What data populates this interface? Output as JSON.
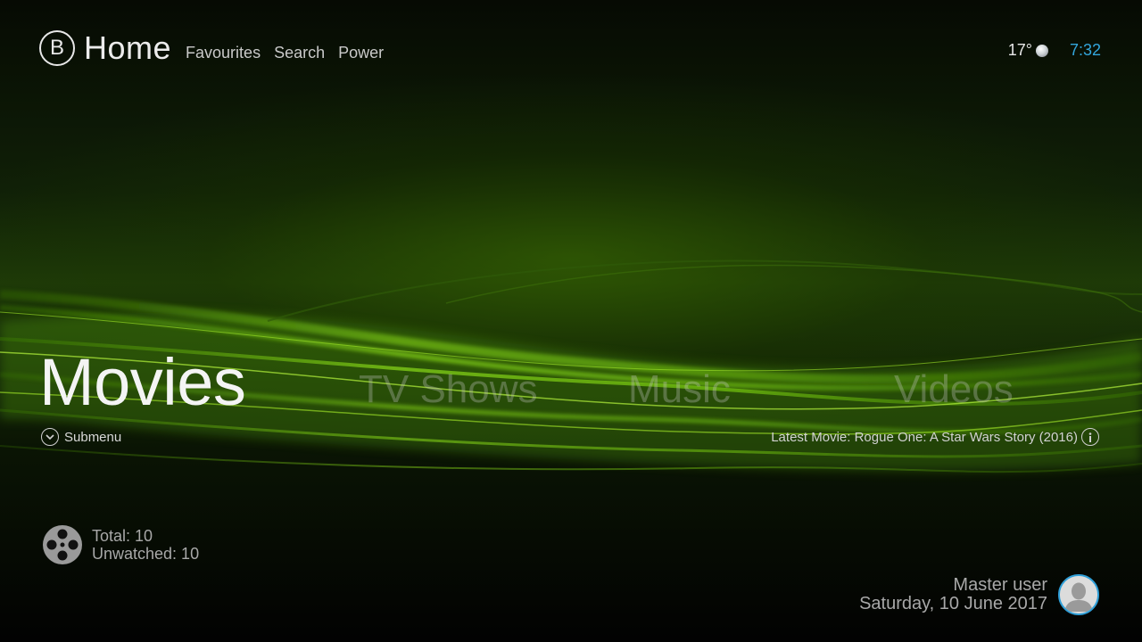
{
  "header": {
    "logo_letter": "B",
    "title": "Home",
    "nav": [
      "Favourites",
      "Search",
      "Power"
    ]
  },
  "status": {
    "temperature": "17°",
    "weather_icon": "weather-clear-icon",
    "time": "7:32",
    "time_color": "#33a6dc"
  },
  "main_menu": {
    "items": [
      "Movies",
      "TV Shows",
      "Music",
      "Videos"
    ],
    "selected": "Movies",
    "submenu_label": "Submenu",
    "latest": "Latest Movie: Rogue One: A Star Wars Story (2016)"
  },
  "stats": {
    "total": "Total: 10",
    "unwatched": "Unwatched: 10"
  },
  "user": {
    "name": "Master user",
    "date": "Saturday, 10 June 2017",
    "accent": "#2f9fd8"
  },
  "theme": {
    "background_accent": "#5ea814"
  }
}
